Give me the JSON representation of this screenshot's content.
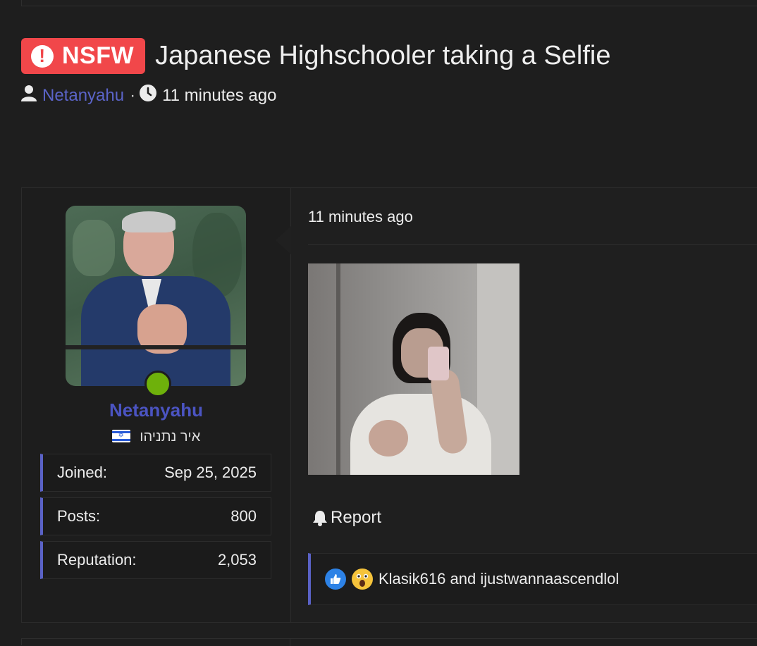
{
  "thread": {
    "badge": "NSFW",
    "badge_icon": "exclamation-circle-icon",
    "title": "Japanese Highschooler taking a Selfie",
    "author": "Netanyahu",
    "separator": "·",
    "time": "11 minutes ago"
  },
  "user": {
    "name": "Netanyahu",
    "title": "איר נתניהו",
    "flag": "israel-flag-icon",
    "online": true,
    "online_color": "#6eb10b",
    "stats": [
      {
        "label": "Joined:",
        "value": "Sep 25, 2025"
      },
      {
        "label": "Posts:",
        "value": "800"
      },
      {
        "label": "Reputation:",
        "value": "2,053"
      }
    ]
  },
  "post": {
    "time": "11 minutes ago",
    "report_label": "Report",
    "reactions_text": "Klasik616 and ijustwannaascendlol",
    "reaction_icons": [
      "like-icon",
      "wow-icon"
    ]
  },
  "colors": {
    "accent": "#5a62c6",
    "username": "#4b54c2",
    "nsfw": "#f1474a",
    "background": "#1e1e1e"
  }
}
